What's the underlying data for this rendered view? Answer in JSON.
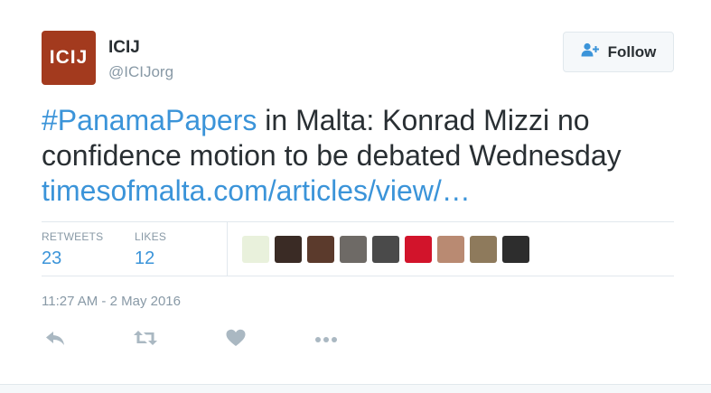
{
  "author": {
    "display_name": "ICIJ",
    "handle": "@ICIJorg",
    "avatar_text": "ICIJ",
    "avatar_color": "#a33a1e"
  },
  "follow_button": {
    "label": "Follow",
    "icon": "follow-person-plus-icon"
  },
  "tweet": {
    "hashtag": "#PanamaPapers",
    "body": " in Malta: Konrad Mizzi no confidence motion to be debated Wednesday ",
    "link_text": "timesofmalta.com/articles/view/…",
    "link_color": "#3b94d9"
  },
  "stats": {
    "retweets_label": "RETWEETS",
    "retweets_value": "23",
    "likes_label": "LIKES",
    "likes_value": "12"
  },
  "likers": [
    {
      "name": "liker-avatar-1",
      "color": "#e9f1dc"
    },
    {
      "name": "liker-avatar-2",
      "color": "#3a2b25"
    },
    {
      "name": "liker-avatar-3",
      "color": "#5b3a2c"
    },
    {
      "name": "liker-avatar-4",
      "color": "#6e6a66"
    },
    {
      "name": "liker-avatar-5",
      "color": "#4a4a4a"
    },
    {
      "name": "liker-avatar-6",
      "color": "#d2142b"
    },
    {
      "name": "liker-avatar-7",
      "color": "#b98a72"
    },
    {
      "name": "liker-avatar-8",
      "color": "#8e7a5c"
    },
    {
      "name": "liker-avatar-9",
      "color": "#2d2d2d"
    }
  ],
  "timestamp": "11:27 AM - 2 May 2016",
  "actions": [
    {
      "name": "reply-icon"
    },
    {
      "name": "retweet-icon"
    },
    {
      "name": "like-heart-icon"
    },
    {
      "name": "more-dots-icon"
    }
  ]
}
